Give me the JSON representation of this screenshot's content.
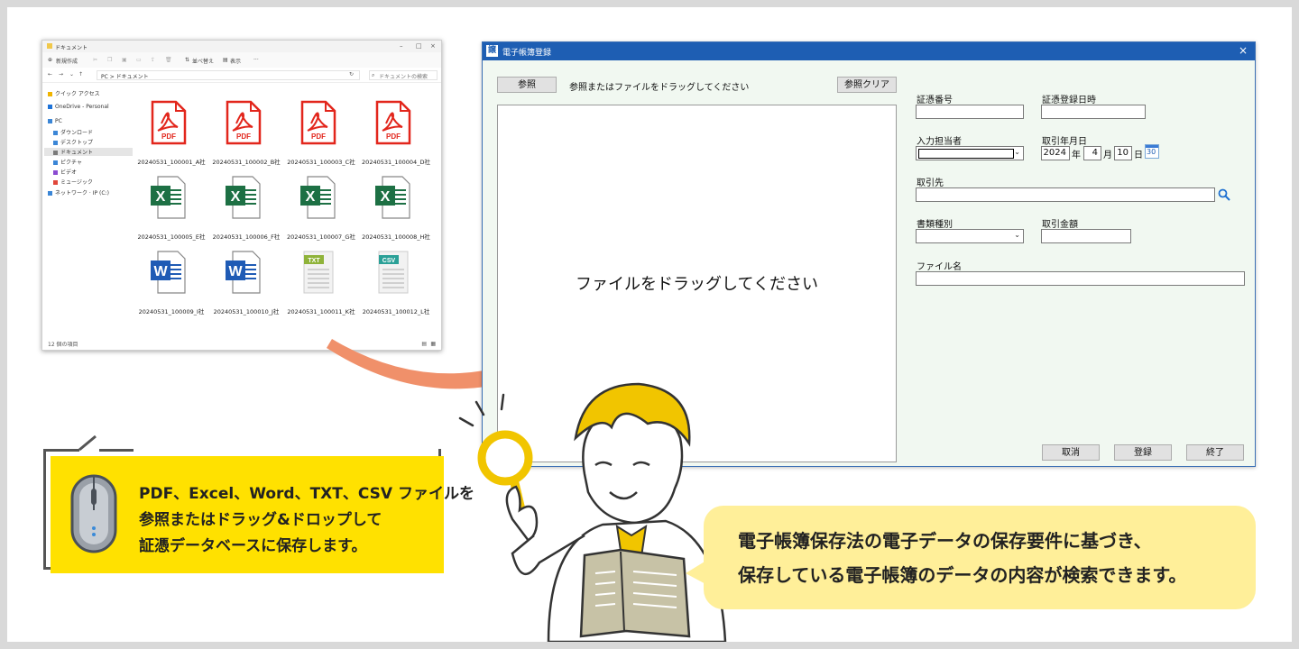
{
  "explorer": {
    "title": "ドキュメント",
    "toolbar": [
      "新規作成",
      "並べ替え",
      "表示",
      "···"
    ],
    "address": "PC > ドキュメント",
    "search_placeholder": "ドキュメントの検索",
    "nav": [
      {
        "label": "クイック アクセス",
        "color": "#f0b400"
      },
      {
        "label": "OneDrive - Personal",
        "color": "#1e73d8"
      },
      {
        "label": "PC",
        "color": "#3b86d6"
      },
      {
        "label": "ダウンロード",
        "color": "#3b86d6"
      },
      {
        "label": "デスクトップ",
        "color": "#3b86d6"
      },
      {
        "label": "ドキュメント",
        "color": "#7a7a7a"
      },
      {
        "label": "ピクチャ",
        "color": "#3b86d6"
      },
      {
        "label": "ビデオ",
        "color": "#8a4bd1"
      },
      {
        "label": "ミュージック",
        "color": "#e0463a"
      },
      {
        "label": "ネットワーク · IP (C:)",
        "color": "#3b86d6"
      }
    ],
    "status": "12 個の項目",
    "files": [
      {
        "name": "20240531_100001_A社",
        "type": "PDF"
      },
      {
        "name": "20240531_100002_B社",
        "type": "PDF"
      },
      {
        "name": "20240531_100003_C社",
        "type": "PDF"
      },
      {
        "name": "20240531_100004_D社",
        "type": "PDF"
      },
      {
        "name": "20240531_100005_E社",
        "type": "X"
      },
      {
        "name": "20240531_100006_F社",
        "type": "X"
      },
      {
        "name": "20240531_100007_G社",
        "type": "X"
      },
      {
        "name": "20240531_100008_H社",
        "type": "X"
      },
      {
        "name": "20240531_100009_I社",
        "type": "W"
      },
      {
        "name": "20240531_100010_J社",
        "type": "W"
      },
      {
        "name": "20240531_100011_K社",
        "type": "TXT"
      },
      {
        "name": "20240531_100012_L社",
        "type": "CSV"
      }
    ]
  },
  "register": {
    "title": "電子帳簿登録",
    "logo": "譲",
    "close": "×",
    "browse_label": "参照",
    "hint": "参照またはファイルをドラッグしてください",
    "clear_label": "参照クリア",
    "drop_message": "ファイルをドラッグしてください",
    "fields": {
      "voucher_no": "証憑番号",
      "reg_datetime": "証憑登録日時",
      "person": "入力担当者",
      "date_label": "取引年月日",
      "year": "2024",
      "year_unit": "年",
      "month": "4",
      "month_unit": "月",
      "day": "10",
      "day_unit": "日",
      "cal_day": "30",
      "partner": "取引先",
      "doc_type": "書類種別",
      "amount": "取引金額",
      "filename": "ファイル名"
    },
    "buttons": {
      "cancel": "取消",
      "register": "登録",
      "exit": "終了"
    }
  },
  "callouts": {
    "left": [
      "PDF、Excel、Word、TXT、CSV ファイルを",
      "参照またはドラッグ&ドロップして",
      "証憑データベースに保存します。"
    ],
    "right": [
      "電子帳簿保存法の電子データの保存要件に基づき、",
      "保存している電子帳簿のデータの内容が検索できます。"
    ]
  },
  "colors": {
    "pdf": "#e2261c",
    "excel": "#1d7044",
    "word": "#1f5bb5",
    "txt": "#8fb33a",
    "csv": "#2aa097",
    "arrow": "#f0906a",
    "yellow": "#ffe100",
    "light_yellow": "#ffef99",
    "window_title": "#1e5eb3"
  }
}
